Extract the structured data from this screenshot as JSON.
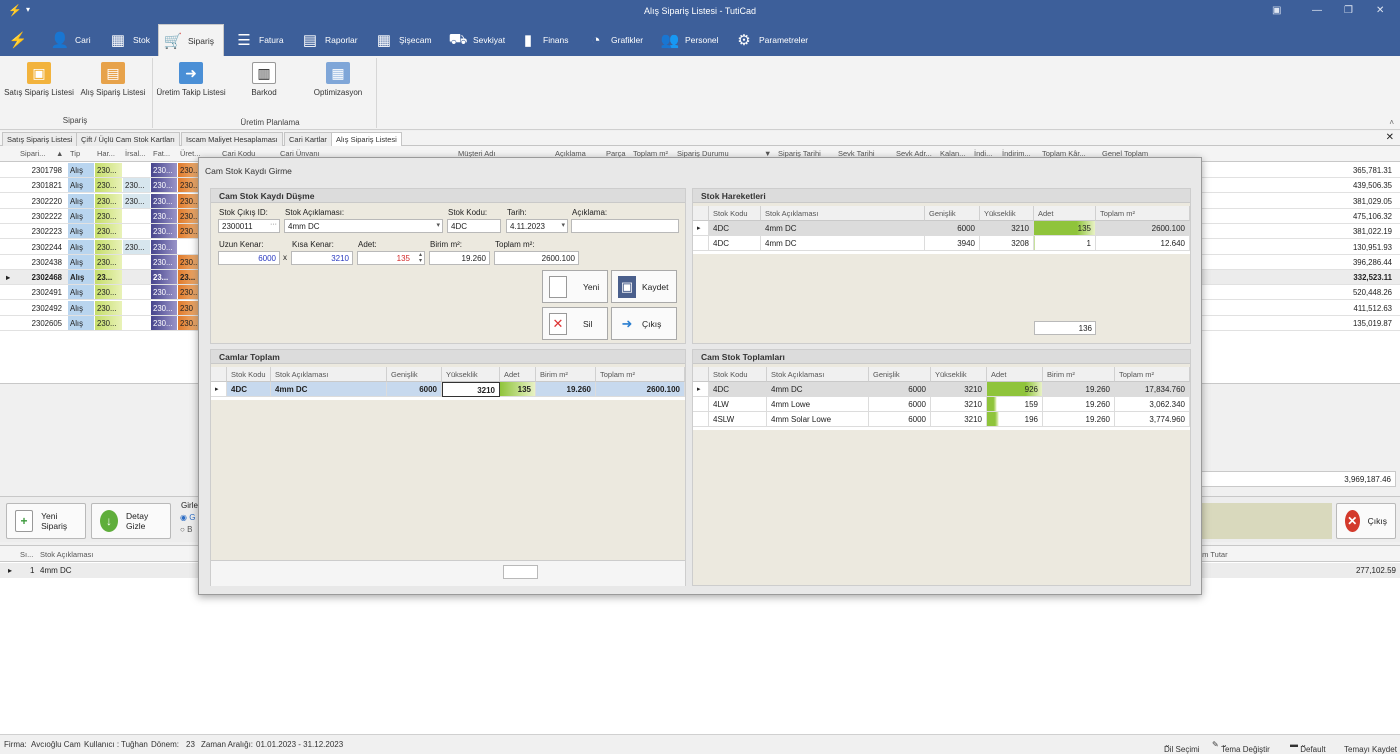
{
  "window": {
    "title": "Alış Sipariş Listesi - TutiCad"
  },
  "menu": [
    {
      "label": "Cari",
      "icon": "person-icon"
    },
    {
      "label": "Stok",
      "icon": "box-icon"
    },
    {
      "label": "Sipariş",
      "icon": "order-icon"
    },
    {
      "label": "Fatura",
      "icon": "document-icon"
    },
    {
      "label": "Raporlar",
      "icon": "report-icon"
    },
    {
      "label": "Şişecam",
      "icon": "grid-icon"
    },
    {
      "label": "Sevkiyat",
      "icon": "truck-icon"
    },
    {
      "label": "Finans",
      "icon": "bar-chart-icon"
    },
    {
      "label": "Grafikler",
      "icon": "pie-chart-icon"
    },
    {
      "label": "Personel",
      "icon": "people-icon"
    },
    {
      "label": "Parametreler",
      "icon": "gear-icon"
    }
  ],
  "ribbon": {
    "buttons": [
      "Satış Sipariş Listesi",
      "Alış Sipariş Listesi",
      "Üretim Takip Listesi",
      "Barkod",
      "Optimizasyon"
    ],
    "groups": [
      "Sipariş",
      "Üretim Planlama"
    ]
  },
  "doc_tabs": [
    "Satış Sipariş Listesi",
    "Çift / Üçlü Cam Stok Kartları",
    "Iscam Maliyet Hesaplaması",
    "Cari Kartlar",
    "Alış Sipariş Listesi"
  ],
  "grid": {
    "headers": [
      "Sipari...",
      "Tip",
      "Har...",
      "İrsal...",
      "Fat...",
      "Üret...",
      "Cari Kodu",
      "Cari Ünvanı",
      "Müşteri Adı",
      "Açıklama",
      "Parça",
      "Toplam m²",
      "Sipariş Durumu",
      "Sipariş Tarihi",
      "Sevk Tarihi",
      "Sevk Adr...",
      "Kalan...",
      "İndi...",
      "İndirim...",
      "Toplam Kâr...",
      "Genel Toplam"
    ],
    "rows": [
      {
        "no": "2301798",
        "tip": "Alış",
        "har": "230...",
        "irs": "",
        "fat": "230...",
        "ure": "230...",
        "total": "365,781.31"
      },
      {
        "no": "2301821",
        "tip": "Alış",
        "har": "230...",
        "irs": "230...",
        "fat": "230...",
        "ure": "230...",
        "total": "439,506.35"
      },
      {
        "no": "2302220",
        "tip": "Alış",
        "har": "230...",
        "irs": "230...",
        "fat": "230...",
        "ure": "230...",
        "total": "381,029.05"
      },
      {
        "no": "2302222",
        "tip": "Alış",
        "har": "230...",
        "irs": "",
        "fat": "230...",
        "ure": "230...",
        "total": "475,106.32"
      },
      {
        "no": "2302223",
        "tip": "Alış",
        "har": "230...",
        "irs": "",
        "fat": "230...",
        "ure": "230...",
        "total": "381,022.19"
      },
      {
        "no": "2302244",
        "tip": "Alış",
        "har": "230...",
        "irs": "230...",
        "fat": "230...",
        "ure": "",
        "total": "130,951.93"
      },
      {
        "no": "2302438",
        "tip": "Alış",
        "har": "230...",
        "irs": "",
        "fat": "230...",
        "ure": "230...",
        "total": "396,286.44"
      },
      {
        "no": "2302468",
        "tip": "Alış",
        "har": "23...",
        "irs": "",
        "fat": "23...",
        "ure": "23...",
        "total": "332,523.11"
      },
      {
        "no": "2302491",
        "tip": "Alış",
        "har": "230...",
        "irs": "",
        "fat": "230...",
        "ure": "230...",
        "total": "520,448.26"
      },
      {
        "no": "2302492",
        "tip": "Alış",
        "har": "230...",
        "irs": "",
        "fat": "230...",
        "ure": "230",
        "total": "411,512.63"
      },
      {
        "no": "2302605",
        "tip": "Alış",
        "har": "230...",
        "irs": "",
        "fat": "230...",
        "ure": "230...",
        "total": "135,019.87"
      }
    ],
    "grand_total": "3,969,187.46"
  },
  "lower": {
    "new_order": "Yeni Sipariş",
    "hide_detail": "Detay Gizle",
    "girl_label": "Girle",
    "exit": "Çıkış",
    "radio1": "G",
    "radio2": "B"
  },
  "detail": {
    "headers": [
      "Sı...",
      "Stok Açıklaması",
      "am Tutar"
    ],
    "row": {
      "no": "1",
      "desc": "4mm DC",
      "amount": "277,102.59"
    }
  },
  "status": {
    "firma": "Firma:",
    "firma_val": "Avcıoğlu Cam",
    "kullanici": "Kullanıcı :",
    "kullanici_val": "Tuğhan",
    "donem": "Dönem:",
    "donem_val": "23",
    "zaman": "Zaman Aralığı:",
    "zaman_val": "01.01.2023   -   31.12.2023",
    "dil": "Dil Seçimi",
    "tema": "Tema Değiştir",
    "default": "Default",
    "kaydet": "Temayı Kaydet"
  },
  "dialog": {
    "title": "Cam Stok Kaydı Girme",
    "form": {
      "header": "Cam Stok Kaydı Düşme",
      "stok_cikis_lbl": "Stok Çıkış ID:",
      "stok_cikis_val": "2300011",
      "stok_acik_lbl": "Stok Açıklaması:",
      "stok_acik_val": "4mm DC",
      "stok_kodu_lbl": "Stok Kodu:",
      "stok_kodu_val": "4DC",
      "tarih_lbl": "Tarih:",
      "tarih_val": "4.11.2023",
      "aciklama_lbl": "Açıklama:",
      "aciklama_val": "",
      "uzun_lbl": "Uzun Kenar:",
      "uzun_val": "6000",
      "x": "x",
      "kisa_lbl": "Kısa Kenar:",
      "kisa_val": "3210",
      "adet_lbl": "Adet:",
      "adet_val": "135",
      "birim_lbl": "Birim m²:",
      "birim_val": "19.260",
      "toplam_lbl": "Toplam m²:",
      "toplam_val": "2600.100",
      "btn_yeni": "Yeni",
      "btn_kaydet": "Kaydet",
      "btn_sil": "Sil",
      "btn_cikis": "Çıkış"
    },
    "hareket": {
      "header": "Stok Hareketleri",
      "cols": [
        "Stok Kodu",
        "Stok Açıklaması",
        "Genişlik",
        "Yükseklik",
        "Adet",
        "Toplam m²"
      ],
      "rows": [
        {
          "kod": "4DC",
          "acik": "4mm DC",
          "gen": "6000",
          "yuk": "3210",
          "adet": "135",
          "top": "2600.100",
          "adet_frac": 1.0
        },
        {
          "kod": "4DC",
          "acik": "4mm DC",
          "gen": "3940",
          "yuk": "3208",
          "adet": "1",
          "top": "12.640",
          "adet_frac": 0.01
        }
      ],
      "total": "136"
    },
    "camlar": {
      "header": "Camlar Toplam",
      "cols": [
        "Stok Kodu",
        "Stok Açıklaması",
        "Genişlik",
        "Yükseklik",
        "Adet",
        "Birim m²",
        "Toplam m²"
      ],
      "row": {
        "kod": "4DC",
        "acik": "4mm DC",
        "gen": "6000",
        "yuk": "3210",
        "adet": "135",
        "birim": "19.260",
        "top": "2600.100"
      },
      "footer": ""
    },
    "toplamlar": {
      "header": "Cam Stok Toplamları",
      "cols": [
        "Stok Kodu",
        "Stok Açıklaması",
        "Genişlik",
        "Yükseklik",
        "Adet",
        "Birim m²",
        "Toplam m²"
      ],
      "rows": [
        {
          "kod": "4DC",
          "acik": "4mm DC",
          "gen": "6000",
          "yuk": "3210",
          "adet": "926",
          "birim": "19.260",
          "top": "17,834.760",
          "adet_frac": 1.0
        },
        {
          "kod": "4LW",
          "acik": "4mm Lowe",
          "gen": "6000",
          "yuk": "3210",
          "adet": "159",
          "birim": "19.260",
          "top": "3,062.340",
          "adet_frac": 0.17
        },
        {
          "kod": "4SLW",
          "acik": "4mm Solar Lowe",
          "gen": "6000",
          "yuk": "3210",
          "adet": "196",
          "birim": "19.260",
          "top": "3,774.960",
          "adet_frac": 0.21
        }
      ]
    }
  }
}
